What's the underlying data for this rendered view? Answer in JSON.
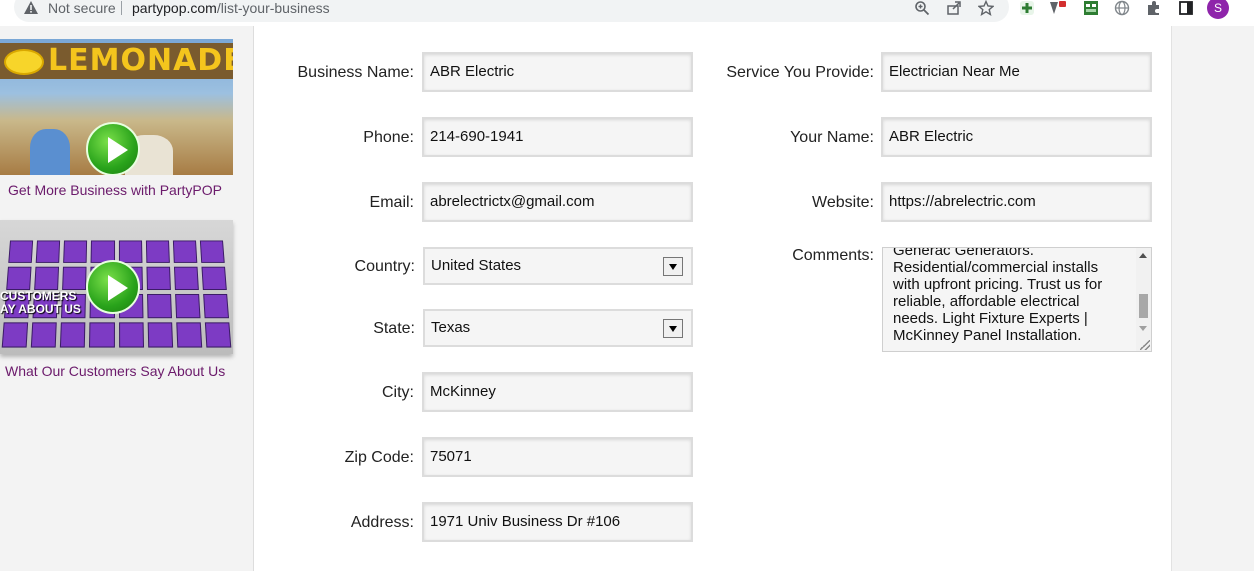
{
  "browser": {
    "security_label": "Not secure",
    "url_domain": "partypop.com",
    "url_path": "/list-your-business",
    "avatar_initial": "S",
    "toolbar_icons": [
      "zoom-icon",
      "share-icon",
      "star-icon",
      "extension-plus-icon",
      "extension-badge-icon",
      "extension-grid-icon",
      "globe-icon",
      "puzzle-icon",
      "sidebar-icon"
    ]
  },
  "sidebar": {
    "video1": {
      "sign_text": "LEMONADE",
      "link": "Get More Business with PartyPOP"
    },
    "video2": {
      "overlay_text_line1": "CUSTOMERS",
      "overlay_text_line2": "AY ABOUT US",
      "link": "What Our Customers Say About Us"
    }
  },
  "form": {
    "business_name": {
      "label": "Business Name:",
      "value": "ABR Electric"
    },
    "phone": {
      "label": "Phone:",
      "value": "214-690-1941"
    },
    "email": {
      "label": "Email:",
      "value": "abrelectrictx@gmail.com"
    },
    "country": {
      "label": "Country:",
      "value": "United States"
    },
    "state": {
      "label": "State:",
      "value": "Texas"
    },
    "city": {
      "label": "City:",
      "value": "McKinney"
    },
    "zip": {
      "label": "Zip Code:",
      "value": "75071"
    },
    "address": {
      "label": "Address:",
      "value": "1971 Univ Business Dr #106"
    },
    "service": {
      "label": "Service You Provide:",
      "value": "Electrician Near Me"
    },
    "your_name": {
      "label": "Your Name:",
      "value": "ABR Electric"
    },
    "website": {
      "label": "Website:",
      "value": "https://abrelectric.com"
    },
    "comments": {
      "label": "Comments:",
      "value": "Generac Generators. Residential/commercial installs with upfront pricing. Trust us for reliable, affordable electrical needs. Light Fixture Experts | McKinney Panel Installation."
    }
  },
  "colors": {
    "link": "#6b1a6b",
    "avatar": "#8e24aa",
    "field_bg": "#f5f5f5"
  }
}
